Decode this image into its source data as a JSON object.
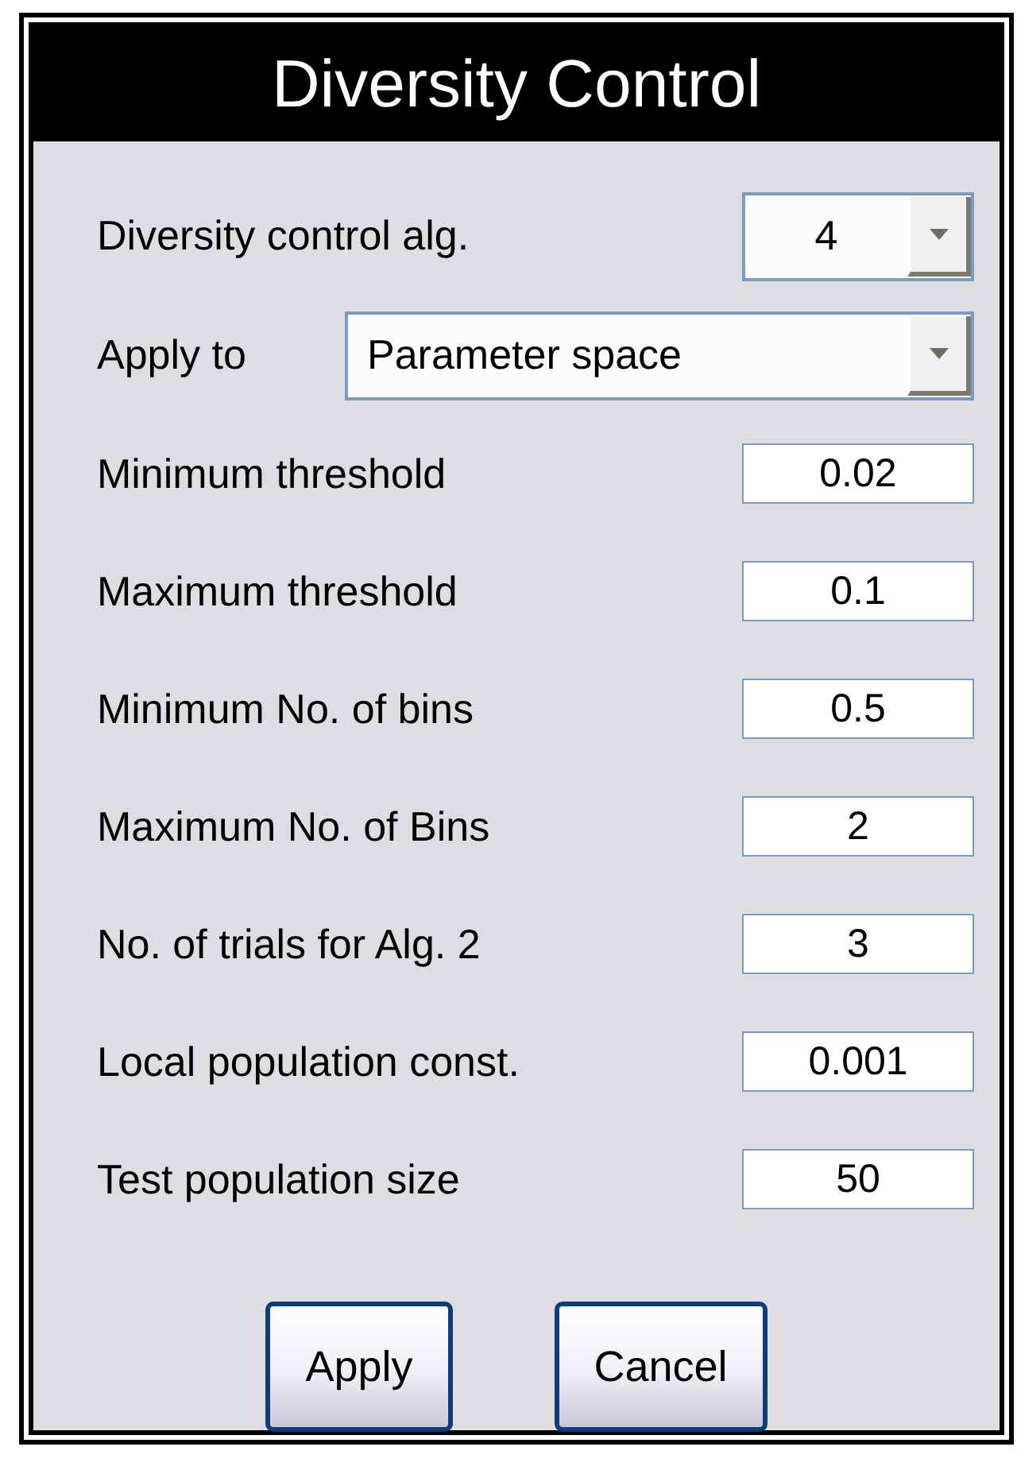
{
  "window": {
    "title": "Diversity Control"
  },
  "dropdowns": [
    {
      "label": "Diversity control alg.",
      "value": "4",
      "kind": "narrow"
    },
    {
      "label": "Apply to",
      "value": "Parameter space",
      "kind": "wide"
    }
  ],
  "fields": [
    {
      "label": "Minimum threshold",
      "value": "0.02"
    },
    {
      "label": "Maximum threshold",
      "value": "0.1"
    },
    {
      "label": "Minimum No. of bins",
      "value": "0.5"
    },
    {
      "label": "Maximum No. of Bins",
      "value": "2"
    },
    {
      "label": "No. of trials for Alg. 2",
      "value": "3"
    },
    {
      "label": "Local population const.",
      "value": "0.001"
    },
    {
      "label": "Test population size",
      "value": "50"
    }
  ],
  "buttons": [
    "Apply",
    "Cancel"
  ]
}
